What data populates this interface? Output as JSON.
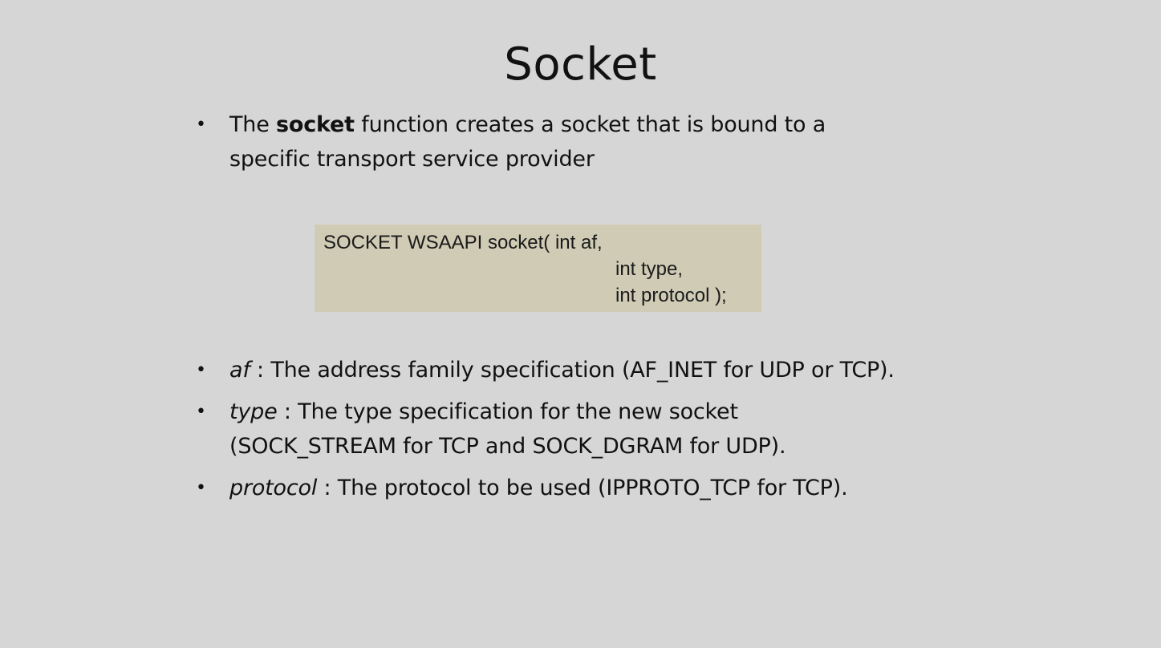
{
  "slide": {
    "title": "Socket",
    "bullet_glyph": "•",
    "intro": {
      "prefix": "The ",
      "keyword": "socket",
      "line1_rest": " function creates a socket that is bound to a",
      "line2": "specific transport service provider"
    },
    "code": {
      "line1": "SOCKET WSAAPI socket( int af,",
      "line2": "int type,",
      "line3": "int protocol );"
    },
    "params": [
      {
        "name": "af",
        "description": " : The address family specification (AF_INET for UDP or TCP)."
      },
      {
        "name": "type",
        "description_line1": " : The type specification for the new socket",
        "description_line2": "(SOCK_STREAM for TCP and SOCK_DGRAM for UDP)."
      },
      {
        "name": "protocol",
        "description": " : The protocol to be used (IPPROTO_TCP for TCP)."
      }
    ],
    "colors": {
      "background": "#d6d6d6",
      "code_background": "#cfcbb5",
      "text": "#111111"
    }
  }
}
